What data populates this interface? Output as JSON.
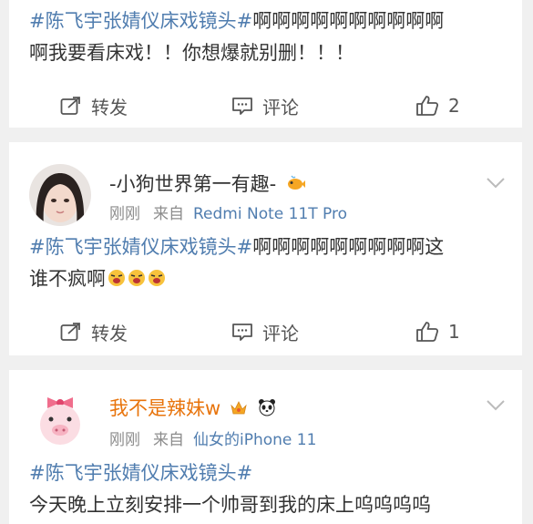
{
  "posts": [
    {
      "line1_tag": "#陈飞宇张婧仪床戏镜头#",
      "line1_rest": "啊啊啊啊啊啊啊啊啊啊",
      "line2": "啊我要看床戏！！你想爆就别删！！！",
      "repost_label": "转发",
      "comment_label": "评论",
      "like_count": "2"
    },
    {
      "username": "-小狗世界第一有趣-",
      "time": "刚刚",
      "from_label": "来自",
      "source": "Redmi Note 11T Pro",
      "line1_tag": "#陈飞宇张婧仪床戏镜头#",
      "line1_rest": "啊啊啊啊啊啊啊啊啊这",
      "line2": "谁不疯啊",
      "repost_label": "转发",
      "comment_label": "评论",
      "like_count": "1"
    },
    {
      "username": "我不是辣妹w",
      "time": "刚刚",
      "from_label": "来自",
      "source": "仙女的iPhone 11",
      "line1_tag": "#陈飞宇张婧仪床戏镜头#",
      "line2": "今天晚上立刻安排一个帅哥到我的床上呜呜呜呜"
    }
  ],
  "colors": {
    "hashtag": "#507daf",
    "username_orange": "#e8740c",
    "meta_gray": "#8c8c8c"
  },
  "icons": {
    "repost": "repost-icon",
    "comment": "comment-icon",
    "like": "thumbs-up-icon",
    "more": "chevron-down-icon"
  }
}
